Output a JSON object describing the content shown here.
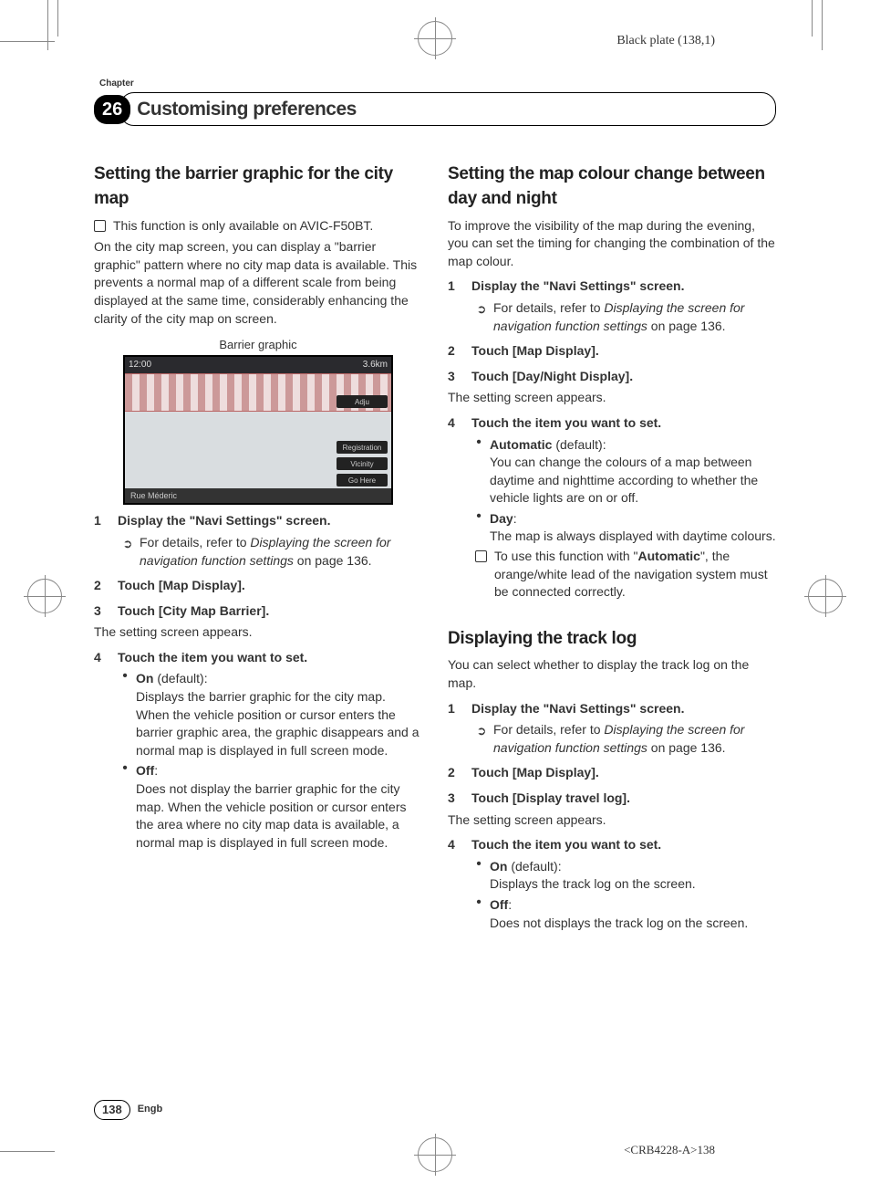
{
  "plate": "Black plate (138,1)",
  "chapter_label": "Chapter",
  "chapter_number": "26",
  "chapter_title": "Customising preferences",
  "left": {
    "h1": "Setting the barrier graphic for the city map",
    "note": "This function is only available on AVIC-F50BT.",
    "intro": "On the city map screen, you can display a \"barrier graphic\" pattern where no city map data is available. This prevents a normal map of a different scale from being displayed at the same time, considerably enhancing the clarity of the city map on screen.",
    "fig_caption": "Barrier graphic",
    "fig": {
      "time": "12:00",
      "dist": "3.6km",
      "adju": "Adju",
      "reg": "Registration",
      "vic": "Vicinity",
      "go": "Go Here",
      "street": "Rue Méderic"
    },
    "s1": "Display the \"Navi Settings\" screen.",
    "s1_ref_a": "For details, refer to ",
    "s1_ref_i": "Displaying the screen for navigation function settings",
    "s1_ref_b": " on page 136.",
    "s2": "Touch [Map Display].",
    "s3": "Touch [City Map Barrier].",
    "s3_after": "The setting screen appears.",
    "s4": "Touch the item you want to set.",
    "opt_on_label": "On",
    "opt_on_default": " (default):",
    "opt_on_body1": "Displays the barrier graphic for the city map.",
    "opt_on_body2": "When the vehicle position or cursor enters the barrier graphic area, the graphic disappears and a normal map is displayed in full screen mode.",
    "opt_off_label": "Off",
    "opt_off_colon": ":",
    "opt_off_body": "Does not display the barrier graphic for the city map. When the vehicle position or cursor enters the area where no city map data is available, a normal map is displayed in full screen mode."
  },
  "right": {
    "h1": "Setting the map colour change between day and night",
    "intro": "To improve the visibility of the map during the evening, you can set the timing for changing the combination of the map colour.",
    "s1": "Display the \"Navi Settings\" screen.",
    "s1_ref_a": "For details, refer to ",
    "s1_ref_i": "Displaying the screen for navigation function settings",
    "s1_ref_b": " on page 136.",
    "s2": "Touch [Map Display].",
    "s3": "Touch [Day/Night Display].",
    "s3_after": "The setting screen appears.",
    "s4": "Touch the item you want to set.",
    "opt_auto_label": "Automatic",
    "opt_auto_default": " (default):",
    "opt_auto_body": "You can change the colours of a map between daytime and nighttime according to whether the vehicle lights are on or off.",
    "opt_day_label": "Day",
    "opt_day_colon": ":",
    "opt_day_body": "The map is always displayed with daytime colours.",
    "auto_note_a": "To use this function with \"",
    "auto_note_b": "Automatic",
    "auto_note_c": "\", the orange/white lead of the navigation system must be connected correctly.",
    "h2": "Displaying the track log",
    "intro2": "You can select whether to display the track log on the map.",
    "t_s1": "Display the \"Navi Settings\" screen.",
    "t_s1_ref_a": "For details, refer to ",
    "t_s1_ref_i": "Displaying the screen for navigation function settings",
    "t_s1_ref_b": " on page 136.",
    "t_s2": "Touch [Map Display].",
    "t_s3": "Touch [Display travel log].",
    "t_s3_after": "The setting screen appears.",
    "t_s4": "Touch the item you want to set.",
    "t_on_label": "On",
    "t_on_default": " (default):",
    "t_on_body": "Displays the track log on the screen.",
    "t_off_label": "Off",
    "t_off_colon": ":",
    "t_off_body": "Does not displays the track log on the screen."
  },
  "page_number": "138",
  "lang": "Engb",
  "docid": "<CRB4228-A>138"
}
